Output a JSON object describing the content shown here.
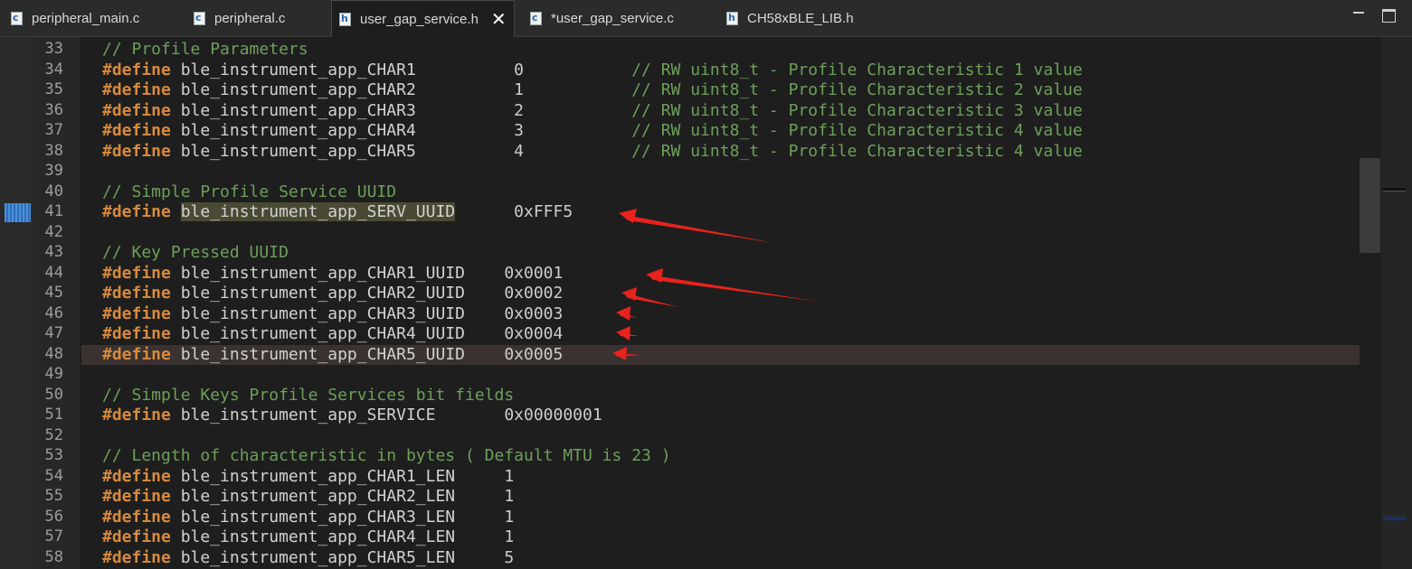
{
  "tabs": [
    {
      "label": "peripheral_main.c",
      "type": "c",
      "active": false
    },
    {
      "label": "peripheral.c",
      "type": "c",
      "active": false
    },
    {
      "label": "user_gap_service.h",
      "type": "h",
      "active": true
    },
    {
      "label": "*user_gap_service.c",
      "type": "c",
      "active": false
    },
    {
      "label": "CH58xBLE_LIB.h",
      "type": "h",
      "active": false
    }
  ],
  "code": {
    "lines": [
      {
        "n": "33",
        "tokens": [
          {
            "t": "cm",
            "v": "// Profile Parameters"
          }
        ]
      },
      {
        "n": "34",
        "tokens": [
          {
            "t": "kw",
            "v": "#define"
          },
          {
            "t": "nm",
            "v": " ble_instrument_app_CHAR1          "
          },
          {
            "t": "val",
            "v": "0           "
          },
          {
            "t": "cm",
            "v": "// RW uint8_t - Profile Characteristic 1 value"
          }
        ]
      },
      {
        "n": "35",
        "tokens": [
          {
            "t": "kw",
            "v": "#define"
          },
          {
            "t": "nm",
            "v": " ble_instrument_app_CHAR2          "
          },
          {
            "t": "val",
            "v": "1           "
          },
          {
            "t": "cm",
            "v": "// RW uint8_t - Profile Characteristic 2 value"
          }
        ]
      },
      {
        "n": "36",
        "tokens": [
          {
            "t": "kw",
            "v": "#define"
          },
          {
            "t": "nm",
            "v": " ble_instrument_app_CHAR3          "
          },
          {
            "t": "val",
            "v": "2           "
          },
          {
            "t": "cm",
            "v": "// RW uint8_t - Profile Characteristic 3 value"
          }
        ]
      },
      {
        "n": "37",
        "tokens": [
          {
            "t": "kw",
            "v": "#define"
          },
          {
            "t": "nm",
            "v": " ble_instrument_app_CHAR4          "
          },
          {
            "t": "val",
            "v": "3           "
          },
          {
            "t": "cm",
            "v": "// RW uint8_t - Profile Characteristic 4 value"
          }
        ]
      },
      {
        "n": "38",
        "tokens": [
          {
            "t": "kw",
            "v": "#define"
          },
          {
            "t": "nm",
            "v": " ble_instrument_app_CHAR5          "
          },
          {
            "t": "val",
            "v": "4           "
          },
          {
            "t": "cm",
            "v": "// RW uint8_t - Profile Characteristic 4 value"
          }
        ]
      },
      {
        "n": "39",
        "tokens": []
      },
      {
        "n": "40",
        "tokens": [
          {
            "t": "cm",
            "v": "// Simple Profile Service UUID"
          }
        ]
      },
      {
        "n": "41",
        "tokens": [
          {
            "t": "kw",
            "v": "#define"
          },
          {
            "t": "nm",
            "v": " "
          },
          {
            "t": "hl",
            "v": "ble_instrument_app_SERV_UUID"
          },
          {
            "t": "nm",
            "v": "      "
          },
          {
            "t": "val",
            "v": "0xFFF5"
          }
        ]
      },
      {
        "n": "42",
        "tokens": []
      },
      {
        "n": "43",
        "tokens": [
          {
            "t": "cm",
            "v": "// Key Pressed UUID"
          }
        ]
      },
      {
        "n": "44",
        "tokens": [
          {
            "t": "kw",
            "v": "#define"
          },
          {
            "t": "nm",
            "v": " ble_instrument_app_CHAR1_UUID    "
          },
          {
            "t": "val",
            "v": "0x0001"
          }
        ]
      },
      {
        "n": "45",
        "tokens": [
          {
            "t": "kw",
            "v": "#define"
          },
          {
            "t": "nm",
            "v": " ble_instrument_app_CHAR2_UUID    "
          },
          {
            "t": "val",
            "v": "0x0002"
          }
        ]
      },
      {
        "n": "46",
        "tokens": [
          {
            "t": "kw",
            "v": "#define"
          },
          {
            "t": "nm",
            "v": " ble_instrument_app_CHAR3_UUID    "
          },
          {
            "t": "val",
            "v": "0x0003"
          }
        ]
      },
      {
        "n": "47",
        "tokens": [
          {
            "t": "kw",
            "v": "#define"
          },
          {
            "t": "nm",
            "v": " ble_instrument_app_CHAR4_UUID    "
          },
          {
            "t": "val",
            "v": "0x0004"
          }
        ]
      },
      {
        "n": "48",
        "tokens": [
          {
            "t": "kw",
            "v": "#define"
          },
          {
            "t": "nm",
            "v": " ble_instrument_app_CHAR5_UUID    "
          },
          {
            "t": "val",
            "v": "0x0005"
          }
        ]
      },
      {
        "n": "49",
        "tokens": []
      },
      {
        "n": "50",
        "tokens": [
          {
            "t": "cm",
            "v": "// Simple Keys Profile Services bit fields"
          }
        ]
      },
      {
        "n": "51",
        "tokens": [
          {
            "t": "kw",
            "v": "#define"
          },
          {
            "t": "nm",
            "v": " ble_instrument_app_SERVICE       "
          },
          {
            "t": "val",
            "v": "0x00000001"
          }
        ]
      },
      {
        "n": "52",
        "tokens": []
      },
      {
        "n": "53",
        "tokens": [
          {
            "t": "cm",
            "v": "// Length of characteristic in bytes ( Default MTU is 23 )"
          }
        ]
      },
      {
        "n": "54",
        "tokens": [
          {
            "t": "kw",
            "v": "#define"
          },
          {
            "t": "nm",
            "v": " ble_instrument_app_CHAR1_LEN     "
          },
          {
            "t": "val",
            "v": "1"
          }
        ]
      },
      {
        "n": "55",
        "tokens": [
          {
            "t": "kw",
            "v": "#define"
          },
          {
            "t": "nm",
            "v": " ble_instrument_app_CHAR2_LEN     "
          },
          {
            "t": "val",
            "v": "1"
          }
        ]
      },
      {
        "n": "56",
        "tokens": [
          {
            "t": "kw",
            "v": "#define"
          },
          {
            "t": "nm",
            "v": " ble_instrument_app_CHAR3_LEN     "
          },
          {
            "t": "val",
            "v": "1"
          }
        ]
      },
      {
        "n": "57",
        "tokens": [
          {
            "t": "kw",
            "v": "#define"
          },
          {
            "t": "nm",
            "v": " ble_instrument_app_CHAR4_LEN     "
          },
          {
            "t": "val",
            "v": "1"
          }
        ]
      },
      {
        "n": "58",
        "tokens": [
          {
            "t": "kw",
            "v": "#define"
          },
          {
            "t": "nm",
            "v": " ble_instrument_app_CHAR5_LEN     "
          },
          {
            "t": "val",
            "v": "5"
          }
        ]
      }
    ]
  },
  "colors": {
    "keyword": "#d78a3c",
    "comment": "#6e9f5a",
    "annotation_arrow": "#e8221d"
  }
}
